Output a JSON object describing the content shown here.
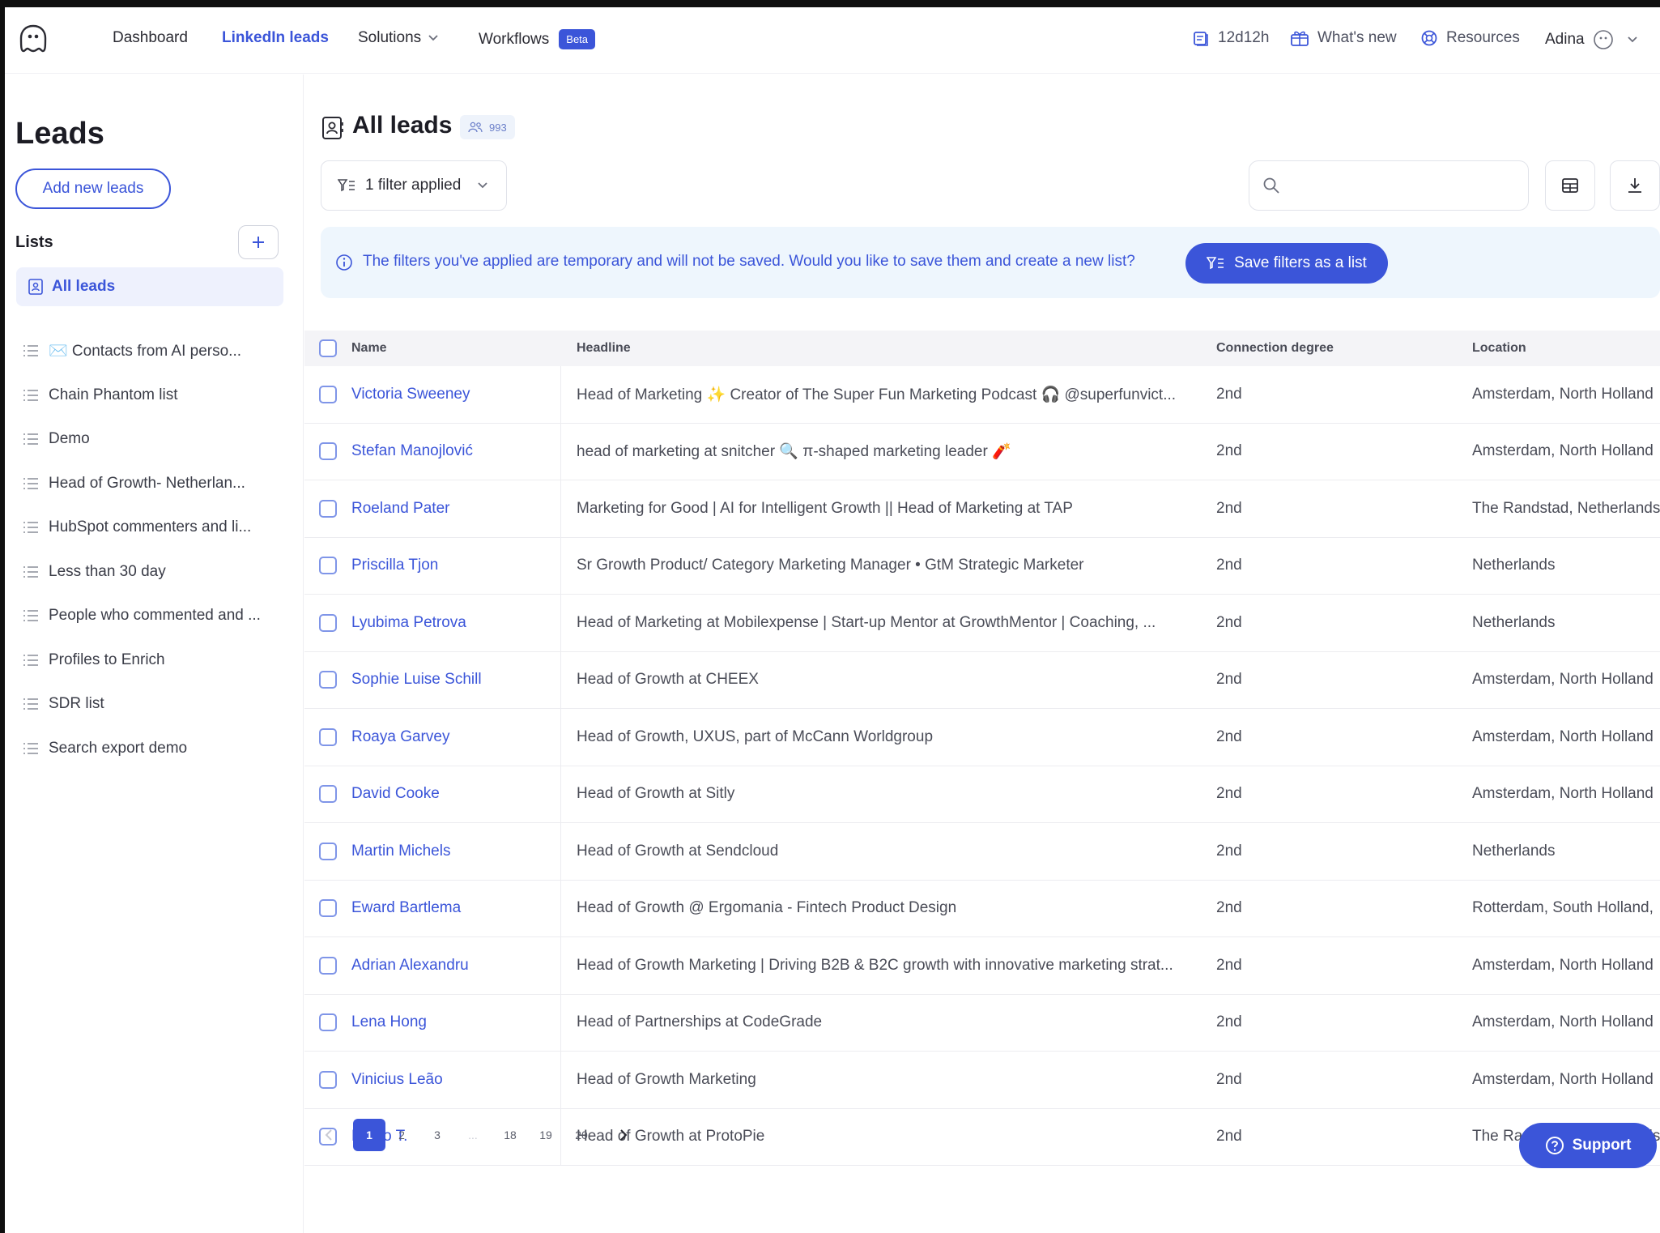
{
  "nav": {
    "items": [
      {
        "label": "Dashboard"
      },
      {
        "label": "LinkedIn leads"
      },
      {
        "label": "Solutions"
      },
      {
        "label": "Workflows",
        "badge": "Beta"
      }
    ],
    "credits": "12d12h",
    "whats_new": "What's new",
    "resources": "Resources",
    "user": "Adina"
  },
  "sidebar": {
    "title": "Leads",
    "add_button": "Add new leads",
    "lists_label": "Lists",
    "active_item": "All leads",
    "items": [
      {
        "label": "✉️ Contacts from AI perso..."
      },
      {
        "label": "Chain Phantom list"
      },
      {
        "label": "Demo"
      },
      {
        "label": "Head of Growth- Netherlan..."
      },
      {
        "label": "HubSpot commenters and li..."
      },
      {
        "label": "Less than 30 day"
      },
      {
        "label": "People who commented and ..."
      },
      {
        "label": "Profiles to Enrich"
      },
      {
        "label": "SDR list"
      },
      {
        "label": "Search export demo"
      }
    ]
  },
  "main": {
    "title": "All leads",
    "count": "993",
    "filter_label": "1 filter applied",
    "search_placeholder": "",
    "banner_text": "The filters you've applied are temporary and will not be saved. Would you like to save them and create a new list?",
    "save_button": "Save filters as a list"
  },
  "table": {
    "columns": [
      "Name",
      "Headline",
      "Connection degree",
      "Location"
    ],
    "rows": [
      {
        "name": "Victoria Sweeney",
        "headline": "Head of Marketing ✨ Creator of The Super Fun Marketing Podcast 🎧 @superfunvict...",
        "degree": "2nd",
        "location": "Amsterdam, North Holland"
      },
      {
        "name": "Stefan Manojlović",
        "headline": "head of marketing at snitcher 🔍 π-shaped marketing leader 🧨",
        "degree": "2nd",
        "location": "Amsterdam, North Holland"
      },
      {
        "name": "Roeland Pater",
        "headline": "Marketing for Good | AI for Intelligent Growth || Head of Marketing at TAP",
        "degree": "2nd",
        "location": "The Randstad, Netherlands"
      },
      {
        "name": "Priscilla Tjon",
        "headline": "Sr Growth Product/ Category Marketing Manager • GtM Strategic Marketer",
        "degree": "2nd",
        "location": "Netherlands"
      },
      {
        "name": "Lyubima Petrova",
        "headline": "Head of Marketing at Mobilexpense | Start-up Mentor at GrowthMentor | Coaching, ...",
        "degree": "2nd",
        "location": "Netherlands"
      },
      {
        "name": "Sophie Luise Schill",
        "headline": "Head of Growth at CHEEX",
        "degree": "2nd",
        "location": "Amsterdam, North Holland"
      },
      {
        "name": "Roaya Garvey",
        "headline": "Head of Growth, UXUS, part of McCann Worldgroup",
        "degree": "2nd",
        "location": "Amsterdam, North Holland"
      },
      {
        "name": "David Cooke",
        "headline": "Head of Growth at Sitly",
        "degree": "2nd",
        "location": "Amsterdam, North Holland"
      },
      {
        "name": "Martin Michels",
        "headline": "Head of Growth at Sendcloud",
        "degree": "2nd",
        "location": "Netherlands"
      },
      {
        "name": "Eward Bartlema",
        "headline": "Head of Growth @ Ergomania - Fintech Product Design",
        "degree": "2nd",
        "location": "Rotterdam, South Holland,"
      },
      {
        "name": "Adrian Alexandru",
        "headline": "Head of Growth Marketing | Driving B2B & B2C growth with innovative marketing strat...",
        "degree": "2nd",
        "location": "Amsterdam, North Holland"
      },
      {
        "name": "Lena Hong",
        "headline": "Head of Partnerships at CodeGrade",
        "degree": "2nd",
        "location": "Amsterdam, North Holland"
      },
      {
        "name": "Vinicius Leão",
        "headline": "Head of Growth Marketing",
        "degree": "2nd",
        "location": "Amsterdam, North Holland"
      },
      {
        "name": "Fredo T.",
        "headline": "Head of Growth at ProtoPie",
        "degree": "2nd",
        "location": "The Randstad, Netherlands"
      }
    ]
  },
  "pagination": {
    "pages": [
      "1",
      "2",
      "3",
      "...",
      "18",
      "19",
      "20"
    ],
    "current": "1"
  },
  "support_label": "Support",
  "colors": {
    "accent": "#3b55d9",
    "banner_bg": "#eef6fd",
    "active_bg": "#eef1fd"
  }
}
